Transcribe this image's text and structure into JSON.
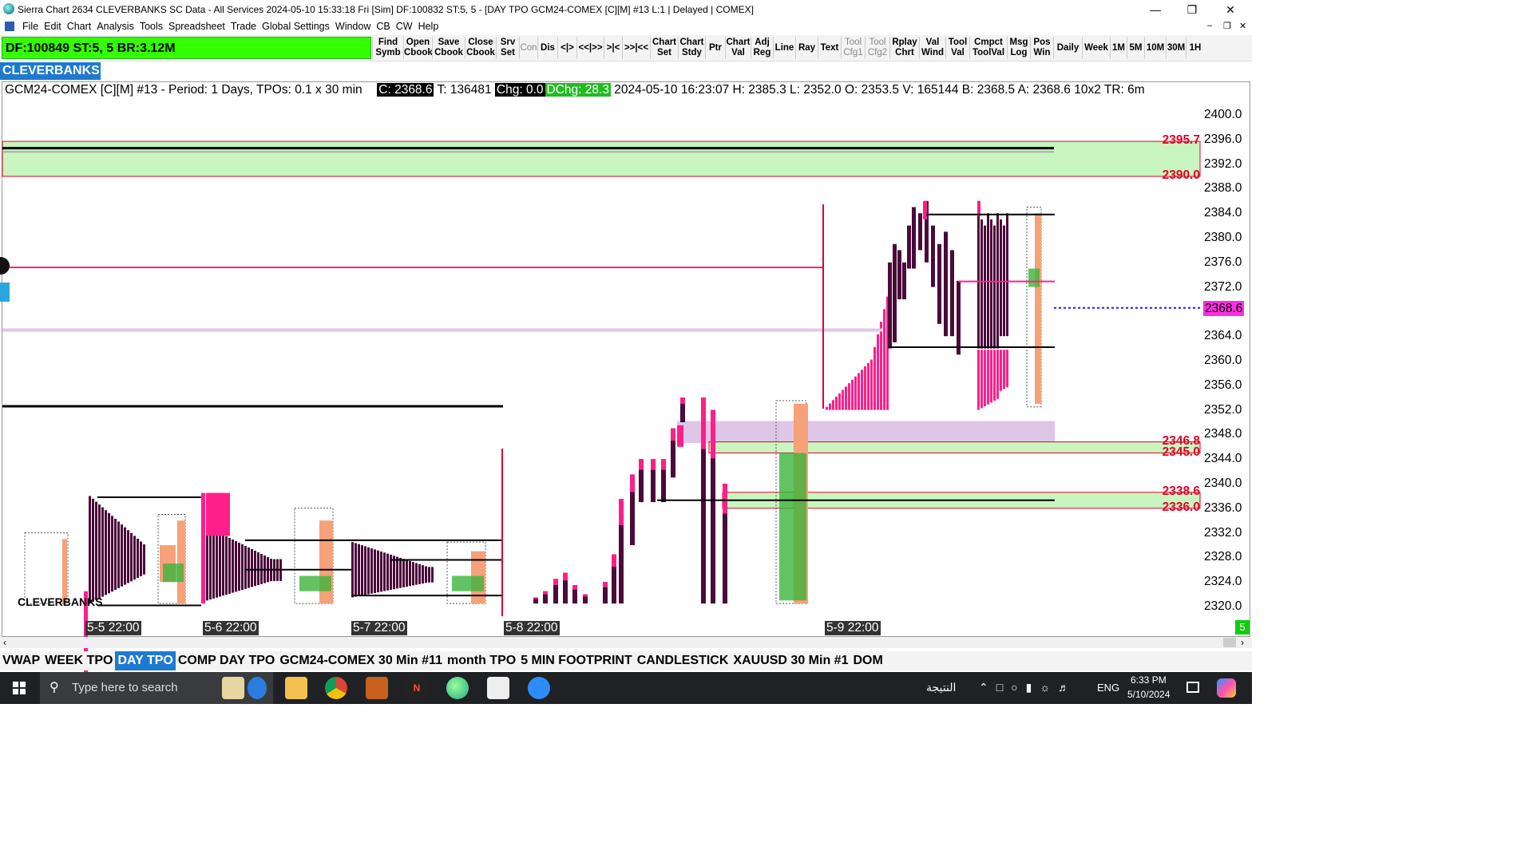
{
  "window": {
    "title": "Sierra Chart 2634 CLEVERBANKS SC Data - All Services 2024-05-10  15:33:18 Fri [Sim] DF:100832  ST:5, 5  - [DAY TPO GCM24-COMEX [C][M] #13 L:1 | Delayed | COMEX]"
  },
  "menu": [
    "File",
    "Edit",
    "Chart",
    "Analysis",
    "Tools",
    "Spreadsheet",
    "Trade",
    "Global Settings",
    "Window",
    "CB",
    "CW",
    "Help"
  ],
  "status_bar": "DF:100849  ST:5, 5   BR:3.12M",
  "toolbar": [
    {
      "l1": "Find",
      "l2": "Symb",
      "dim": false
    },
    {
      "l1": "Open",
      "l2": "Cbook",
      "dim": false
    },
    {
      "l1": "Save",
      "l2": "Cbook",
      "dim": false
    },
    {
      "l1": "Close",
      "l2": "Cbook",
      "dim": false
    },
    {
      "l1": "Srv",
      "l2": "Set",
      "dim": false
    },
    {
      "l1": "Con",
      "l2": "",
      "dim": true
    },
    {
      "l1": "Dis",
      "l2": "",
      "dim": false
    },
    {
      "l1": "<|>",
      "l2": "",
      "dim": false
    },
    {
      "l1": "<<|>>",
      "l2": "",
      "dim": false
    },
    {
      "l1": ">|<",
      "l2": "",
      "dim": false
    },
    {
      "l1": ">>|<<",
      "l2": "",
      "dim": false
    },
    {
      "l1": "Chart",
      "l2": "Set",
      "dim": false
    },
    {
      "l1": "Chart",
      "l2": "Stdy",
      "dim": false
    },
    {
      "l1": "Ptr",
      "l2": "",
      "dim": false
    },
    {
      "l1": "Chart",
      "l2": "Val",
      "dim": false
    },
    {
      "l1": "Adj",
      "l2": "Reg",
      "dim": false
    },
    {
      "l1": "Line",
      "l2": "",
      "dim": false
    },
    {
      "l1": "Ray",
      "l2": "",
      "dim": false
    },
    {
      "l1": "Text",
      "l2": "",
      "dim": false
    },
    {
      "l1": "Tool",
      "l2": "Cfg1",
      "dim": true
    },
    {
      "l1": "Tool",
      "l2": "Cfg2",
      "dim": true
    },
    {
      "l1": "Rplay",
      "l2": "Chrt",
      "dim": false
    },
    {
      "l1": "Val",
      "l2": "Wind",
      "dim": false
    },
    {
      "l1": "Tool",
      "l2": "Val",
      "dim": false
    },
    {
      "l1": "Cmpct",
      "l2": "ToolVal",
      "dim": false
    },
    {
      "l1": "Msg",
      "l2": "Log",
      "dim": false
    },
    {
      "l1": "Pos",
      "l2": "Win",
      "dim": false
    },
    {
      "l1": "Daily",
      "l2": "",
      "dim": false
    },
    {
      "l1": "Week",
      "l2": "",
      "dim": false
    },
    {
      "l1": "1M",
      "l2": "",
      "dim": false
    },
    {
      "l1": "5M",
      "l2": "",
      "dim": false
    },
    {
      "l1": "10M",
      "l2": "",
      "dim": false
    },
    {
      "l1": "30M",
      "l2": "",
      "dim": false
    },
    {
      "l1": "1H",
      "l2": "",
      "dim": false
    }
  ],
  "brand": "CLEVERBANKS",
  "chart_header": {
    "symbol": "GCM24-COMEX [C][M] #13 - Period: 1 Days, TPOs: 0.1 x 30 min",
    "close": "C: 2368.6",
    "trades": "T: 136481",
    "chg": "Chg: 0.0",
    "dchg": "DChg: 28.3",
    "rest": "2024-05-10 16:23:07 H: 2385.3 L: 2352.0 O: 2353.5 V: 165144 B: 2368.5 A: 2368.6 10x2 TR: 6m"
  },
  "price_axis": [
    "2400.0",
    "2396.0",
    "2392.0",
    "2388.0",
    "2384.0",
    "2380.0",
    "2376.0",
    "2372.0",
    "2368.0",
    "2364.0",
    "2360.0",
    "2356.0",
    "2352.0",
    "2348.0",
    "2344.0",
    "2340.0",
    "2336.0",
    "2332.0",
    "2328.0",
    "2324.0",
    "2320.0"
  ],
  "current_price": "2368.6",
  "level_labels": [
    "2395.7",
    "2390.0",
    "2346.8",
    "2345.0",
    "2338.6",
    "2336.0"
  ],
  "date_labels": [
    "5-5  22:00",
    "5-6  22:00",
    "5-7  22:00",
    "5-8  22:00",
    "5-9  22:00"
  ],
  "watermark": "CLEVERBANKS",
  "corner_badge": "5",
  "tabs": [
    "VWAP",
    "WEEK TPO",
    "DAY TPO",
    "COMP DAY TPO",
    "GCM24-COMEX  30 Min  #11",
    "month  TPO",
    "5 MIN FOOTPRINT",
    "CANDLESTICK",
    "XAUUSD  30 Min  #1",
    "DOM"
  ],
  "active_tab": "DAY TPO",
  "taskbar": {
    "search_placeholder": "Type here to search",
    "weather": "النتيجة",
    "lang": "ENG",
    "time": "6:33 PM",
    "date": "5/10/2024"
  },
  "colors": {
    "dfbar": "#33ff00",
    "brand": "#1e79d0",
    "tpo_dark": "#4a0a3a",
    "tpo_pink": "#ff1e8a",
    "profile_orange": "#f5a27a",
    "zone_green": "#c8f5c0",
    "zone_lavender": "#e0c6e6",
    "level_red": "#e0002a"
  }
}
